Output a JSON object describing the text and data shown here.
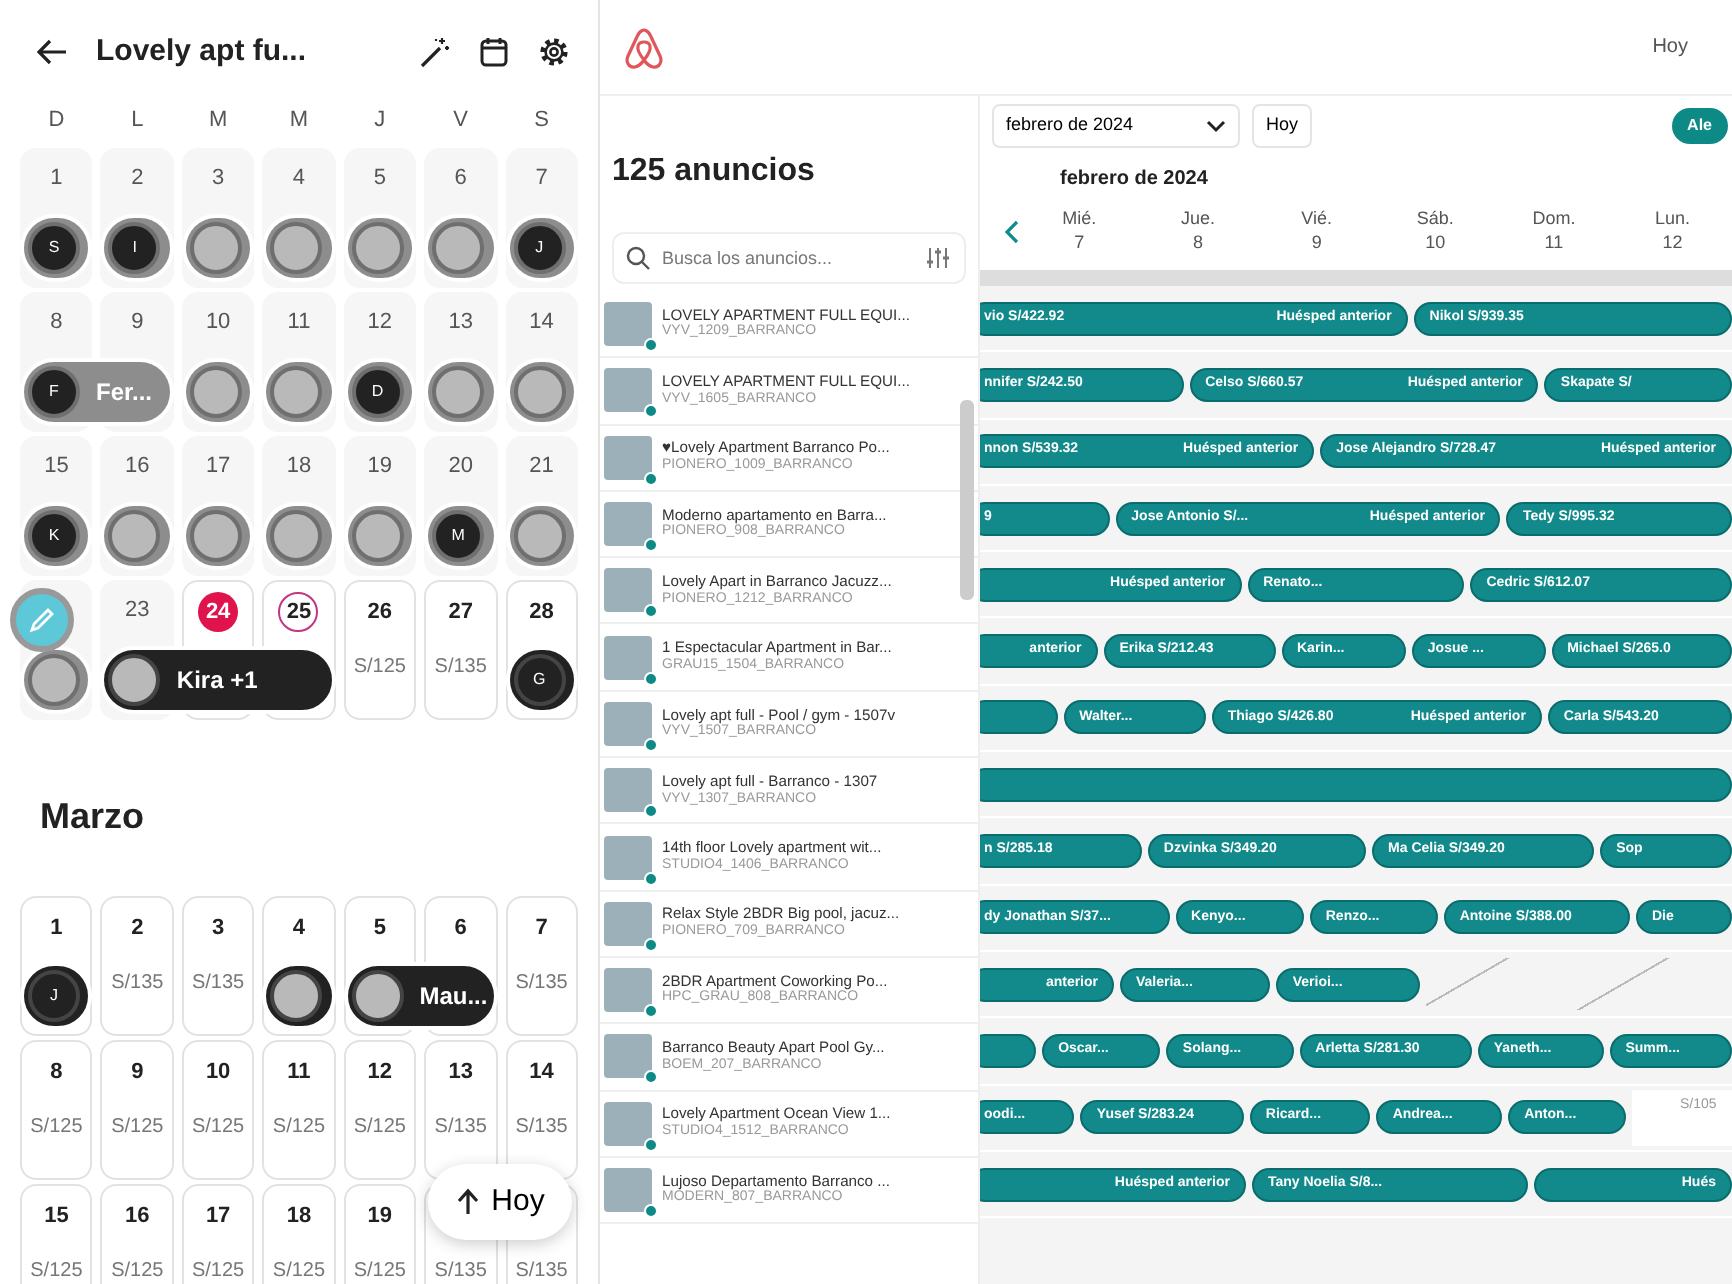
{
  "mobile": {
    "title": "Lovely apt fu...",
    "weekdays": [
      "D",
      "L",
      "M",
      "M",
      "J",
      "V",
      "S"
    ],
    "months": [
      {
        "weeks": [
          {
            "days": [
              {
                "day": "1",
                "past": true,
                "today": false,
                "selected": false,
                "guest": {
                  "initial": "S",
                  "past": true
                }
              },
              {
                "day": "2",
                "past": true,
                "today": false,
                "selected": false,
                "guest": {
                  "initial": "I",
                  "past": true
                }
              },
              {
                "day": "3",
                "past": true,
                "today": false,
                "selected": false,
                "guest": {
                  "past": true
                }
              },
              {
                "day": "4",
                "past": true,
                "today": false,
                "selected": false,
                "guest": {
                  "past": true
                }
              },
              {
                "day": "5",
                "past": true,
                "today": false,
                "selected": false,
                "guest": {
                  "past": true
                }
              },
              {
                "day": "6",
                "past": true,
                "today": false,
                "selected": false,
                "guest": {
                  "past": true
                }
              },
              {
                "day": "7",
                "past": true,
                "today": false,
                "selected": false,
                "guest": {
                  "initial": "J",
                  "past": true
                }
              }
            ]
          },
          {
            "days": [
              {
                "day": "8",
                "past": true,
                "today": false,
                "selected": false,
                "guest": {
                  "initial": "F",
                  "name": "Fer...",
                  "past": true
                }
              },
              {
                "day": "9",
                "past": true,
                "today": false,
                "selected": false
              },
              {
                "day": "10",
                "past": true,
                "today": false,
                "selected": false,
                "guest": {
                  "past": true
                }
              },
              {
                "day": "11",
                "past": true,
                "today": false,
                "selected": false,
                "guest": {
                  "past": true
                }
              },
              {
                "day": "12",
                "past": true,
                "today": false,
                "selected": false,
                "guest": {
                  "initial": "D",
                  "past": true
                }
              },
              {
                "day": "13",
                "past": true,
                "today": false,
                "selected": false,
                "guest": {
                  "past": true
                }
              },
              {
                "day": "14",
                "past": true,
                "today": false,
                "selected": false,
                "guest": {
                  "past": true
                }
              }
            ]
          },
          {
            "days": [
              {
                "day": "15",
                "past": true,
                "today": false,
                "selected": false,
                "guest": {
                  "initial": "K",
                  "past": true
                }
              },
              {
                "day": "16",
                "past": true,
                "today": false,
                "selected": false,
                "guest": {
                  "past": true
                }
              },
              {
                "day": "17",
                "past": true,
                "today": false,
                "selected": false,
                "guest": {
                  "past": true
                }
              },
              {
                "day": "18",
                "past": true,
                "today": false,
                "selected": false,
                "guest": {
                  "past": true
                }
              },
              {
                "day": "19",
                "past": true,
                "today": false,
                "selected": false,
                "guest": {
                  "past": true
                }
              },
              {
                "day": "20",
                "past": true,
                "today": false,
                "selected": false,
                "guest": {
                  "initial": "M",
                  "past": true
                }
              },
              {
                "day": "21",
                "past": true,
                "today": false,
                "selected": false,
                "guest": {
                  "past": true
                }
              }
            ]
          },
          {
            "days": [
              {
                "past": true,
                "guest": {
                  "past": true
                }
              },
              {
                "day": "23",
                "past": true,
                "today": false,
                "selected": false,
                "guest": {
                  "name": "Kira +1",
                  "past": false
                }
              },
              {
                "day": "24",
                "past": false,
                "today": true,
                "selected": false
              },
              {
                "day": "25",
                "past": false,
                "today": false,
                "selected": true
              },
              {
                "day": "26",
                "past": false,
                "today": false,
                "selected": false,
                "price": "S/125"
              },
              {
                "day": "27",
                "past": false,
                "today": false,
                "selected": false,
                "price": "S/135"
              },
              {
                "day": "28",
                "past": false,
                "today": false,
                "selected": false,
                "guest": {
                  "initial": "G",
                  "past": false
                }
              }
            ]
          }
        ]
      },
      {
        "name": "Marzo",
        "weeks": [
          {
            "days": [
              {
                "day": "1",
                "past": false,
                "today": false,
                "selected": false,
                "guest": {
                  "initial": "J",
                  "past": false
                }
              },
              {
                "day": "2",
                "past": false,
                "today": false,
                "selected": false,
                "price": "S/135"
              },
              {
                "day": "3",
                "past": false,
                "today": false,
                "selected": false,
                "price": "S/135"
              },
              {
                "day": "4",
                "past": false,
                "today": false,
                "selected": false,
                "guest": {
                  "past": false
                }
              },
              {
                "day": "5",
                "past": false,
                "today": false,
                "selected": false,
                "guest": {
                  "name": "Mau...",
                  "past": false
                }
              },
              {
                "day": "6",
                "past": false,
                "today": false,
                "selected": false
              },
              {
                "day": "7",
                "past": false,
                "today": false,
                "selected": false,
                "price": "S/135"
              }
            ]
          },
          {
            "days": [
              {
                "day": "8",
                "past": false,
                "today": false,
                "selected": false,
                "price": "S/125"
              },
              {
                "day": "9",
                "past": false,
                "today": false,
                "selected": false,
                "price": "S/125"
              },
              {
                "day": "10",
                "past": false,
                "today": false,
                "selected": false,
                "price": "S/125"
              },
              {
                "day": "11",
                "past": false,
                "today": false,
                "selected": false,
                "price": "S/125"
              },
              {
                "day": "12",
                "past": false,
                "today": false,
                "selected": false,
                "price": "S/125"
              },
              {
                "day": "13",
                "past": false,
                "today": false,
                "selected": false,
                "price": "S/135"
              },
              {
                "day": "14",
                "past": false,
                "today": false,
                "selected": false,
                "price": "S/135"
              }
            ]
          },
          {
            "days": [
              {
                "day": "15",
                "past": false,
                "today": false,
                "selected": false,
                "price": "S/125"
              },
              {
                "day": "16",
                "past": false,
                "today": false,
                "selected": false,
                "price": "S/125"
              },
              {
                "day": "17",
                "past": false,
                "today": false,
                "selected": false,
                "price": "S/125"
              },
              {
                "day": "18",
                "past": false,
                "today": false,
                "selected": false,
                "price": "S/125"
              },
              {
                "day": "19",
                "past": false,
                "today": false,
                "selected": false,
                "price": "S/125"
              },
              {
                "past": false,
                "price": "S/135"
              },
              {
                "past": false,
                "price": "S/135"
              }
            ]
          }
        ]
      }
    ],
    "today_button": "Hoy"
  },
  "desktop": {
    "header_link": "Hoy",
    "listing_count": "125 anuncios",
    "search": {
      "placeholder": "Busca los anuncios..."
    },
    "month_select": "febrero de 2024",
    "today_button": "Hoy",
    "filter_chip": "Ale",
    "month_title": "febrero de 2024",
    "days": [
      {
        "weekday": "Mié.",
        "day": "7"
      },
      {
        "weekday": "Jue.",
        "day": "8"
      },
      {
        "weekday": "Vié.",
        "day": "9"
      },
      {
        "weekday": "Sáb.",
        "day": "10"
      },
      {
        "weekday": "Dom.",
        "day": "11"
      },
      {
        "weekday": "Lun.",
        "day": "12"
      }
    ],
    "listings": [
      {
        "title": "LOVELY APARTMENT FULL EQUI...",
        "code": "VYV_1209_BARRANCO",
        "reservations": [
          {
            "kind": "booking",
            "guest": "vio S/422.92",
            "tag": "Huésped anterior"
          },
          {
            "kind": "booking",
            "guest": "Nikol S/939.35"
          }
        ]
      },
      {
        "title": "LOVELY APARTMENT FULL EQUI...",
        "code": "VYV_1605_BARRANCO",
        "reservations": [
          {
            "kind": "booking",
            "guest": "nnifer S/242.50"
          },
          {
            "kind": "booking",
            "guest": "Celso S/660.57",
            "tag": "Huésped anterior"
          },
          {
            "kind": "booking",
            "guest": "Skapate S/"
          }
        ]
      },
      {
        "title": "♥Lovely Apartment Barranco Po...",
        "code": "PIONERO_1009_BARRANCO",
        "reservations": [
          {
            "kind": "booking",
            "guest": "nnon S/539.32",
            "tag": "Huésped anterior"
          },
          {
            "kind": "booking",
            "guest": "Jose Alejandro S/728.47",
            "tag": "Huésped anterior"
          }
        ]
      },
      {
        "title": "Moderno apartamento en Barra...",
        "code": "PIONERO_908_BARRANCO",
        "reservations": [
          {
            "kind": "booking",
            "guest": "9"
          },
          {
            "kind": "booking",
            "guest": "Jose Antonio S/...",
            "tag": "Huésped anterior"
          },
          {
            "kind": "booking",
            "guest": "Tedy S/995.32"
          }
        ]
      },
      {
        "title": "Lovely Apart in Barranco Jacuzz...",
        "code": "PIONERO_1212_BARRANCO",
        "reservations": [
          {
            "kind": "booking",
            "tag": "Huésped anterior"
          },
          {
            "kind": "booking",
            "guest": "Renato..."
          },
          {
            "kind": "booking",
            "guest": "Cedric S/612.07"
          }
        ]
      },
      {
        "title": "1 Espectacular Apartment in Bar...",
        "code": "GRAU15_1504_BARRANCO",
        "reservations": [
          {
            "kind": "booking",
            "tag": "anterior"
          },
          {
            "kind": "booking",
            "guest": "Erika S/212.43"
          },
          {
            "kind": "booking",
            "guest": "Karin..."
          },
          {
            "kind": "booking",
            "guest": "Josue ..."
          },
          {
            "kind": "booking",
            "guest": "Michael S/265.0"
          }
        ]
      },
      {
        "title": "Lovely apt full - Pool / gym - 1507v",
        "code": "VYV_1507_BARRANCO",
        "reservations": [
          {
            "kind": "booking"
          },
          {
            "kind": "booking",
            "guest": "Walter..."
          },
          {
            "kind": "booking",
            "guest": "Thiago S/426.80",
            "tag": "Huésped anterior"
          },
          {
            "kind": "booking",
            "guest": "Carla S/543.20"
          }
        ]
      },
      {
        "title": "Lovely apt full - Barranco - 1307",
        "code": "VYV_1307_BARRANCO",
        "reservations": [
          {
            "kind": "booking"
          }
        ]
      },
      {
        "title": "14th floor Lovely apartment wit...",
        "code": "STUDIO4_1406_BARRANCO",
        "reservations": [
          {
            "kind": "booking",
            "guest": "n S/285.18"
          },
          {
            "kind": "booking",
            "guest": "Dzvinka S/349.20"
          },
          {
            "kind": "booking",
            "guest": "Ma Celia S/349.20"
          },
          {
            "kind": "booking",
            "guest": "Sop"
          }
        ]
      },
      {
        "title": "Relax Style 2BDR Big pool, jacuz...",
        "code": "PIONERO_709_BARRANCO",
        "reservations": [
          {
            "kind": "booking",
            "guest": "dy Jonathan S/37..."
          },
          {
            "kind": "booking",
            "guest": "Kenyo..."
          },
          {
            "kind": "booking",
            "guest": "Renzo..."
          },
          {
            "kind": "booking",
            "guest": "Antoine S/388.00"
          },
          {
            "kind": "booking",
            "guest": "Die"
          }
        ]
      },
      {
        "title": "2BDR Apartment Coworking Po...",
        "code": "HPC_GRAU_808_BARRANCO",
        "reservations": [
          {
            "kind": "booking",
            "tag": "anterior"
          },
          {
            "kind": "booking",
            "guest": "Valeria..."
          },
          {
            "kind": "booking",
            "guest": "Verioi..."
          },
          {
            "kind": "blocked"
          }
        ]
      },
      {
        "title": "Barranco Beauty Apart Pool Gy...",
        "code": "BOEM_207_BARRANCO",
        "reservations": [
          {
            "kind": "booking"
          },
          {
            "kind": "booking",
            "guest": "Oscar..."
          },
          {
            "kind": "booking",
            "guest": "Solang..."
          },
          {
            "kind": "booking",
            "guest": "Arletta S/281.30"
          },
          {
            "kind": "booking",
            "guest": "Yaneth..."
          },
          {
            "kind": "booking",
            "guest": "Summ..."
          }
        ]
      },
      {
        "title": "Lovely Apartment Ocean View 1...",
        "code": "STUDIO4_1512_BARRANCO",
        "reservations": [
          {
            "kind": "booking",
            "guest": "oodi..."
          },
          {
            "kind": "booking",
            "guest": "Yusef S/283.24"
          },
          {
            "kind": "booking",
            "guest": "Ricard..."
          },
          {
            "kind": "booking",
            "guest": "Andrea..."
          },
          {
            "kind": "booking",
            "guest": "Anton..."
          },
          {
            "kind": "price",
            "guest": "S/105"
          }
        ]
      },
      {
        "title": "Lujoso Departamento Barranco ...",
        "code": "MODERN_807_BARRANCO",
        "reservations": [
          {
            "kind": "booking",
            "tag": "Huésped anterior"
          },
          {
            "kind": "booking",
            "guest": "Tany Noelia S/8..."
          },
          {
            "kind": "booking",
            "tag": "Hués"
          }
        ]
      }
    ]
  }
}
